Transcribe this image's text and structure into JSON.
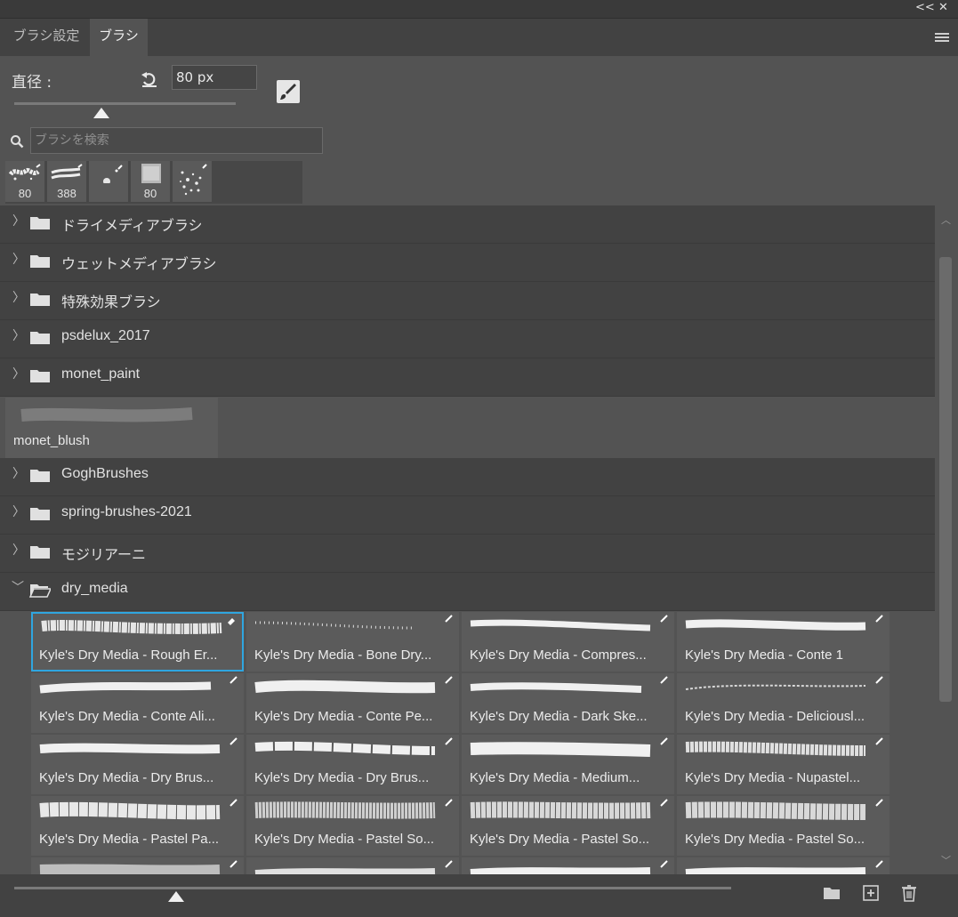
{
  "window": {
    "collapse_label": "<<",
    "close_label": "✕"
  },
  "tabs": [
    {
      "label": "ブラシ設定"
    },
    {
      "label": "ブラシ"
    }
  ],
  "controls": {
    "diameter_label": "直径 :",
    "diameter_value": "80 px",
    "diameter_slider_level": 0.39
  },
  "search": {
    "placeholder": "ブラシを検索",
    "icon": "search-icon"
  },
  "recent_brushes": [
    {
      "num": "80"
    },
    {
      "num": "388"
    },
    {
      "num": ""
    },
    {
      "num": "80"
    },
    {
      "num": ""
    }
  ],
  "groups_top": [
    {
      "name": "ドライメディアブラシ"
    },
    {
      "name": "ウェットメディアブラシ"
    },
    {
      "name": "特殊効果ブラシ"
    },
    {
      "name": "psdelux_2017"
    },
    {
      "name": "monet_paint"
    }
  ],
  "single_brush": {
    "name": "monet_blush"
  },
  "groups_bottom": [
    {
      "name": "GoghBrushes"
    },
    {
      "name": "spring-brushes-2021"
    },
    {
      "name": "モジリアーニ"
    },
    {
      "name": "dry_media",
      "expanded": true
    }
  ],
  "brushes": [
    {
      "name": "Kyle's Dry Media - Rough Er..."
    },
    {
      "name": "Kyle's Dry Media - Bone Dry..."
    },
    {
      "name": "Kyle's Dry Media - Compres..."
    },
    {
      "name": "Kyle's Dry Media - Conte 1"
    },
    {
      "name": "Kyle's Dry Media - Conte Ali..."
    },
    {
      "name": "Kyle's Dry Media - Conte Pe..."
    },
    {
      "name": "Kyle's Dry Media - Dark Ske..."
    },
    {
      "name": "Kyle's Dry Media - Deliciousl..."
    },
    {
      "name": "Kyle's Dry Media - Dry Brus..."
    },
    {
      "name": "Kyle's Dry Media - Dry Brus..."
    },
    {
      "name": "Kyle's Dry Media - Medium..."
    },
    {
      "name": "Kyle's Dry Media - Nupastel..."
    },
    {
      "name": "Kyle's Dry Media - Pastel Pa..."
    },
    {
      "name": "Kyle's Dry Media - Pastel So..."
    },
    {
      "name": "Kyle's Dry Media - Pastel So..."
    },
    {
      "name": "Kyle's Dry Media - Pastel So..."
    }
  ],
  "footer": {
    "preview_size_level": 0.23
  },
  "colors": {
    "accent": "#2fa6e0",
    "panel": "#535353",
    "header": "#424242"
  }
}
